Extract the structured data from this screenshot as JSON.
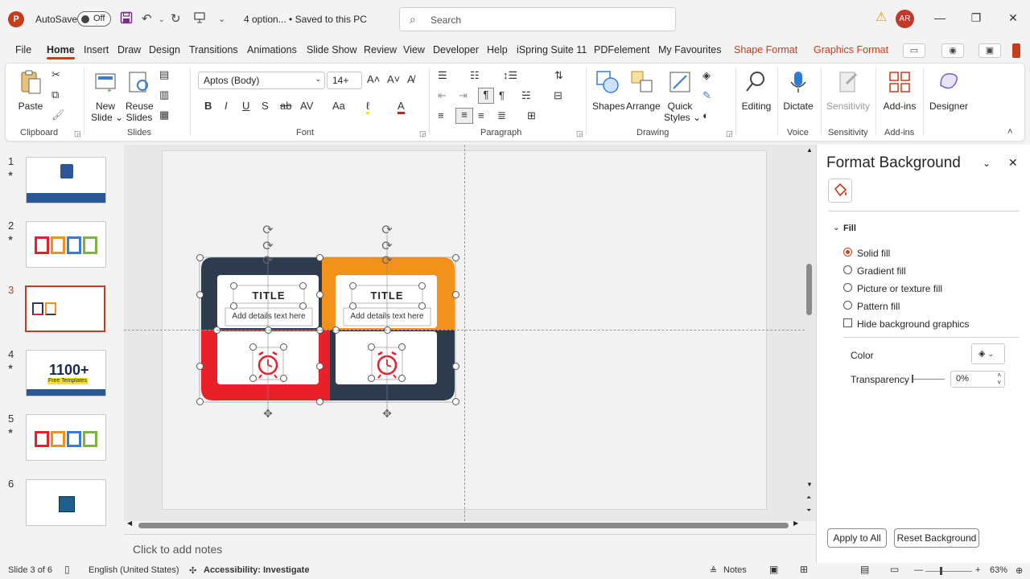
{
  "window": {
    "app_logo": "P",
    "autosave_label": "AutoSave",
    "autosave_state": "Off",
    "doc_title": "4 option... • Saved to this PC",
    "search_placeholder": "Search",
    "user_initials": "AR"
  },
  "tabs": [
    "File",
    "Home",
    "Insert",
    "Draw",
    "Design",
    "Transitions",
    "Animations",
    "Slide Show",
    "Review",
    "View",
    "Developer",
    "Help",
    "iSpring Suite 11",
    "PDFelement",
    "My Favourites",
    "Shape Format",
    "Graphics Format"
  ],
  "active_tab": "Home",
  "ribbon": {
    "clipboard": {
      "paste": "Paste",
      "label": "Clipboard"
    },
    "slides": {
      "new_slide": "New",
      "new_slide2": "Slide ⌄",
      "reuse": "Reuse",
      "reuse2": "Slides",
      "label": "Slides"
    },
    "font": {
      "family": "Aptos (Body)",
      "size": "14+",
      "label": "Font"
    },
    "paragraph": {
      "label": "Paragraph"
    },
    "drawing": {
      "shapes": "Shapes",
      "arrange": "Arrange",
      "quick": "Quick",
      "quick2": "Styles ⌄",
      "label": "Drawing"
    },
    "editing": {
      "label": "Editing"
    },
    "voice": {
      "dictate": "Dictate",
      "label": "Voice"
    },
    "sensitivity": {
      "btn": "Sensitivity",
      "label": "Sensitivity"
    },
    "addins": {
      "btn": "Add-ins",
      "label": "Add-ins"
    },
    "designer": {
      "btn": "Designer"
    }
  },
  "slides": [
    {
      "num": "1",
      "star": "★"
    },
    {
      "num": "2",
      "star": "★"
    },
    {
      "num": "3",
      "star": ""
    },
    {
      "num": "4",
      "star": "★"
    },
    {
      "num": "5",
      "star": "★"
    },
    {
      "num": "6",
      "star": ""
    }
  ],
  "thumb4_text": "1100+",
  "thumb4_sub": "Free Templates",
  "slide_content": {
    "title1": "TITLE",
    "title2": "TITLE",
    "detail1": "Add details text here",
    "detail2": "Add details text here",
    "colors": {
      "navy": "#2e3a4d",
      "orange": "#f2921d",
      "red": "#e8202a",
      "accent": "#c43e1c"
    }
  },
  "notes_placeholder": "Click to add notes",
  "format_background": {
    "title": "Format Background",
    "section": "Fill",
    "options": [
      "Solid fill",
      "Gradient fill",
      "Picture or texture fill",
      "Pattern fill"
    ],
    "selected": "Solid fill",
    "hide_graphics": "Hide background graphics",
    "color_label": "Color",
    "transparency_label": "Transparency",
    "transparency_value": "0%",
    "apply_all": "Apply to All",
    "reset": "Reset Background"
  },
  "status": {
    "slide_info": "Slide 3 of 6",
    "language": "English (United States)",
    "accessibility": "Accessibility: Investigate",
    "notes_btn": "Notes",
    "zoom": "63%"
  }
}
